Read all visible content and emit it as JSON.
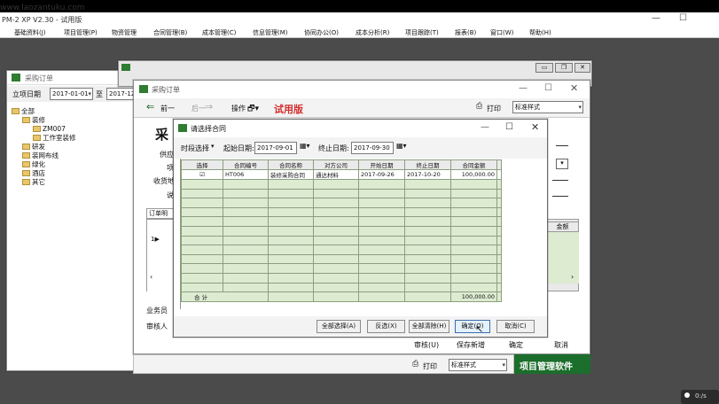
{
  "app": {
    "title": "PM-2 XP V2.30 - 试用版",
    "watermark": "www.laozantuku.com"
  },
  "menu": [
    "基础资料(J)",
    "项目管理(P)",
    "物资管理",
    "合同管理(B)",
    "成本管理(C)",
    "信息管理(M)",
    "协同办公(O)",
    "成本分析(R)",
    "项目跟踪(T)",
    "报表(B)",
    "窗口(W)",
    "帮助(H)"
  ],
  "back_win": {
    "title": "采购订单",
    "date_filter_label": "立项日期",
    "date_from": "2017-01-01",
    "to_label": "至",
    "date_to": "2017-12-",
    "tree": [
      {
        "label": "全部",
        "level": 0
      },
      {
        "label": "装修",
        "level": 1
      },
      {
        "label": "ZM007",
        "level": 2
      },
      {
        "label": "工作室装修",
        "level": 2
      },
      {
        "label": "研发",
        "level": 1
      },
      {
        "label": "装网布线",
        "level": 1
      },
      {
        "label": "绿化",
        "level": 1
      },
      {
        "label": "酒店",
        "level": 1
      },
      {
        "label": "其它",
        "level": 1
      }
    ]
  },
  "order_win": {
    "title": "采购订单",
    "back": "前一",
    "next": "后一",
    "action": "操作",
    "trial": "试用版",
    "print": "打印",
    "print_style": "标准样式",
    "heading": "采",
    "fields": [
      "供应",
      "项",
      "收货地",
      "说"
    ],
    "tab": "订单明",
    "col_amount": "金额",
    "row_marker": "1▶",
    "salesman": "业务员",
    "reviewer": "审核人",
    "btn_review": "审核(U)",
    "btn_save_new": "保存新增",
    "btn_ok": "确定",
    "btn_cancel": "取消"
  },
  "bottom": {
    "print": "打印",
    "style": "标准样式",
    "brand": "项目管理软件"
  },
  "dialog": {
    "title": "请选择合同",
    "period_label": "时段选择",
    "start_label": "起始日期:",
    "start": "2017-09-01",
    "end_label": "终止日期:",
    "end": "2017-09-30",
    "columns": [
      "选择",
      "合同编号",
      "合同名称",
      "对方公司",
      "开始日期",
      "终止日期",
      "合同金额"
    ],
    "rows": [
      {
        "check": "☑",
        "no": "HT006",
        "name": "装修采购合同",
        "company": "通达材料",
        "start": "2017-09-26",
        "end": "2017-10-20",
        "amount": "100,000.00"
      }
    ],
    "total_label": "合  计",
    "total_amount": "100,000.00",
    "buttons": [
      "全部选择(A)",
      "反选(X)",
      "全部清除(H)",
      "确定(O)",
      "取消(C)"
    ]
  },
  "taskbar": {
    "time": "0:/s"
  }
}
